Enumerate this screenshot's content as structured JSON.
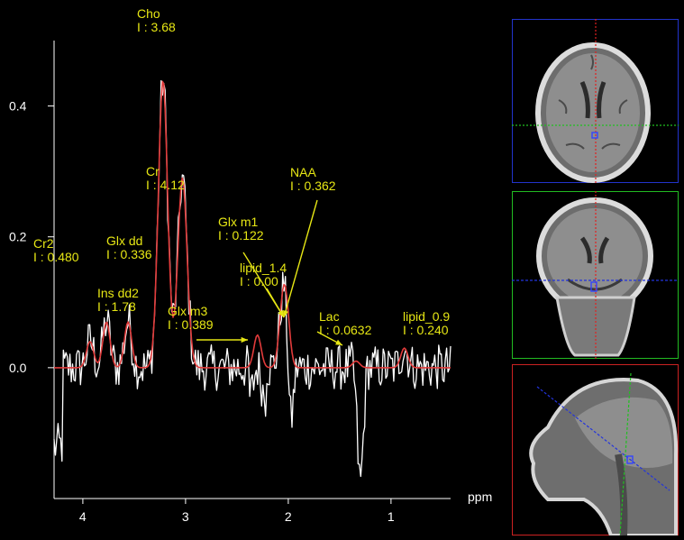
{
  "chart_data": {
    "type": "line",
    "xlabel": "ppm",
    "ylabel": "",
    "xlim": [
      4.28,
      0.42
    ],
    "ylim": [
      -0.2,
      0.5
    ],
    "x_ticks": [
      {
        "value": 4,
        "label": "4"
      },
      {
        "value": 3,
        "label": "3"
      },
      {
        "value": 2,
        "label": "2"
      },
      {
        "value": 1,
        "label": "1"
      }
    ],
    "y_ticks": [
      {
        "value": 0.0,
        "label": "0.0"
      },
      {
        "value": 0.2,
        "label": "0.2"
      },
      {
        "value": 0.4,
        "label": "0.4"
      }
    ],
    "peaks": [
      {
        "name": "Cho",
        "integral": "3.68",
        "ppm": 3.22,
        "amp": 0.44
      },
      {
        "name": "Cr",
        "integral": "4.12",
        "ppm": 3.03,
        "amp": 0.29
      },
      {
        "name": "Cr2",
        "integral": "0.480",
        "ppm": 3.93,
        "amp": 0.04
      },
      {
        "name": "Glx dd",
        "integral": "0.336",
        "ppm": 3.77,
        "amp": 0.07
      },
      {
        "name": "Ins dd2",
        "integral": "1.78",
        "ppm": 3.56,
        "amp": 0.07
      },
      {
        "name": "Glx m3",
        "integral": "0.389",
        "ppm": 2.3,
        "amp": 0.05
      },
      {
        "name": "Glx m1",
        "integral": "0.122",
        "ppm": 2.06,
        "amp": 0.07
      },
      {
        "name": "lipid_1.4",
        "integral": "0.00",
        "ppm": 1.4,
        "amp": 0.0
      },
      {
        "name": "NAA",
        "integral": "0.362",
        "ppm": 2.02,
        "amp": 0.08
      },
      {
        "name": "Lac",
        "integral": "0.0632",
        "ppm": 1.34,
        "amp": 0.01
      },
      {
        "name": "lipid_0.9",
        "integral": "0.240",
        "ppm": 0.87,
        "amp": 0.03
      }
    ],
    "series": [
      {
        "kind": "measured",
        "color": "#ffffff"
      },
      {
        "kind": "fitted",
        "color": "#e23b3b"
      }
    ]
  },
  "colors": {
    "label": "#e6e614",
    "axis": "#ffffff",
    "measured": "#ffffff",
    "fit": "#e23b3b"
  },
  "mri_panels": [
    {
      "view": "axial",
      "border": "#2233cc",
      "cross_v": "#e02020",
      "cross_h": "#20c020"
    },
    {
      "view": "coronal",
      "border": "#22bb22",
      "cross_v": "#e02020",
      "cross_h": "#2233dd"
    },
    {
      "view": "sagittal",
      "border": "#cc2222",
      "cross_v": "#20c020",
      "cross_h": "#2233dd"
    }
  ]
}
